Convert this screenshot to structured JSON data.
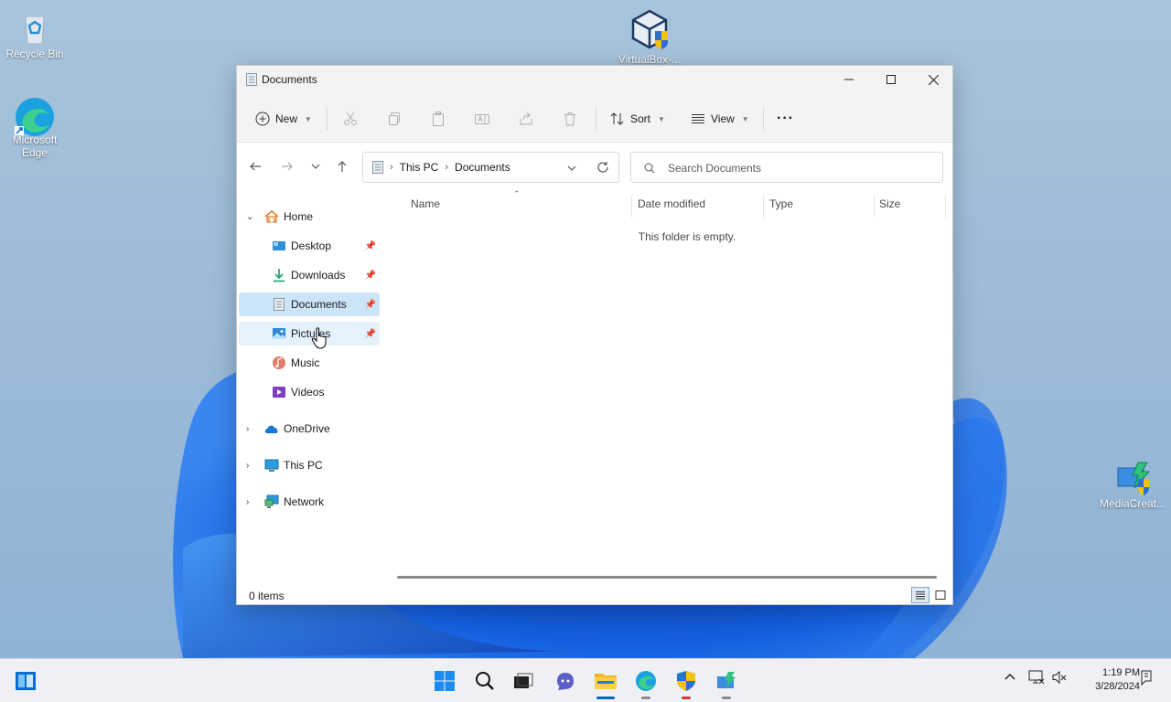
{
  "desktop": {
    "icons": [
      {
        "label": "Recycle Bin"
      },
      {
        "label": "Microsoft Edge"
      },
      {
        "label": "VirtualBox-..."
      },
      {
        "label": "MediaCreat..."
      }
    ]
  },
  "window": {
    "title": "Documents",
    "controls": {
      "minimize": "minimize-icon",
      "maximize": "maximize-icon",
      "close": "close-icon"
    }
  },
  "toolbar": {
    "new_label": "New",
    "sort_label": "Sort",
    "view_label": "View",
    "more_label": "···"
  },
  "address": {
    "crumbs": [
      "This PC",
      "Documents"
    ],
    "search_placeholder": "Search Documents"
  },
  "nav": {
    "home": "Home",
    "quick_access": [
      {
        "label": "Desktop",
        "pinned": true
      },
      {
        "label": "Downloads",
        "pinned": true
      },
      {
        "label": "Documents",
        "pinned": true,
        "selected": true
      },
      {
        "label": "Pictures",
        "pinned": true
      },
      {
        "label": "Music"
      },
      {
        "label": "Videos"
      }
    ],
    "onedrive": "OneDrive",
    "thispc": "This PC",
    "network": "Network"
  },
  "columns": [
    "Name",
    "Date modified",
    "Type",
    "Size"
  ],
  "content": {
    "empty_message": "This folder is empty."
  },
  "status": {
    "item_count": "0 items"
  },
  "taskbar": {
    "clock_time": "1:19 PM",
    "clock_date": "3/28/2024"
  },
  "colors": {
    "accent": "#0067c0",
    "selected_bg": "#cce4f7",
    "wallpaper": "#9ebcd8"
  }
}
